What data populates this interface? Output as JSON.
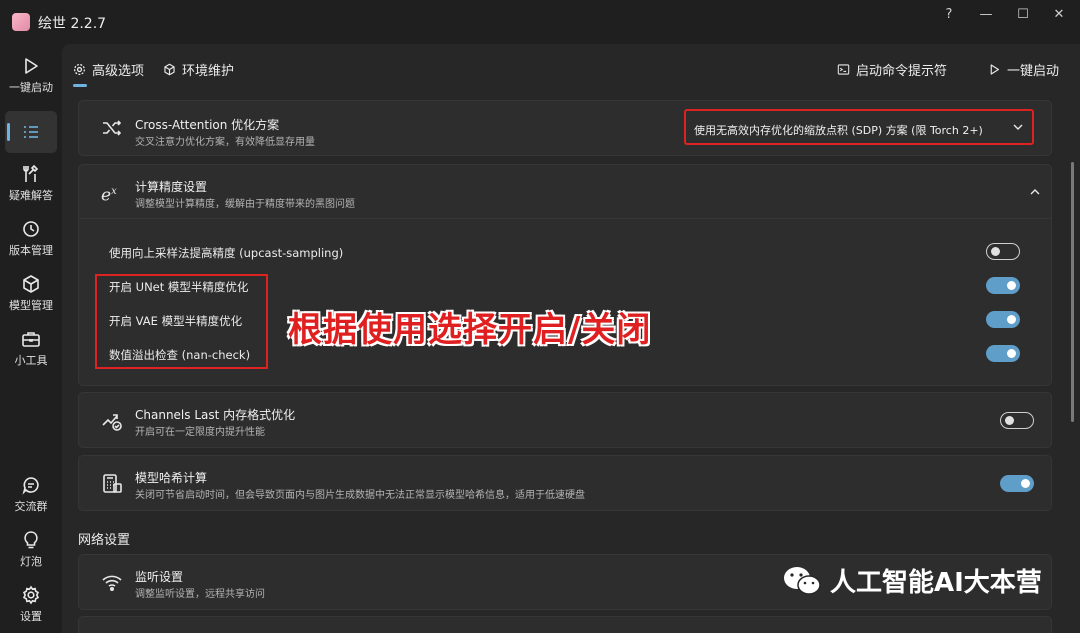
{
  "window": {
    "title": "绘世 2.2.7",
    "help": "?",
    "minimize": "—",
    "maximize": "☐",
    "close": "✕"
  },
  "sidebar": {
    "items": [
      {
        "label": "一键启动"
      },
      {
        "label": ""
      },
      {
        "label": "疑难解答"
      },
      {
        "label": "版本管理"
      },
      {
        "label": "模型管理"
      },
      {
        "label": "小工具"
      },
      {
        "label": "交流群"
      },
      {
        "label": "灯泡"
      },
      {
        "label": "设置"
      }
    ]
  },
  "topbar": {
    "tab_advanced": "高级选项",
    "tab_env": "环境维护",
    "cmd_prompt": "启动命令提示符",
    "one_click": "一键启动"
  },
  "cross_attention": {
    "title": "Cross-Attention 优化方案",
    "desc": "交叉注意力优化方案，有效降低显存用量",
    "selected": "使用无高效内存优化的缩放点积 (SDP) 方案 (限 Torch 2+)"
  },
  "precision": {
    "title": "计算精度设置",
    "desc": "调整模型计算精度，缓解由于精度带来的黑图问题",
    "rows": [
      {
        "label": "使用向上采样法提高精度 (upcast-sampling)",
        "on": false
      },
      {
        "label": "开启 UNet 模型半精度优化",
        "on": true
      },
      {
        "label": "开启 VAE 模型半精度优化",
        "on": true
      },
      {
        "label": "数值溢出检查 (nan-check)",
        "on": true
      }
    ]
  },
  "annotation": "根据使用选择开启/关闭",
  "channels_last": {
    "title": "Channels Last 内存格式优化",
    "desc": "开启可在一定限度内提升性能",
    "on": false
  },
  "model_hash": {
    "title": "模型哈希计算",
    "desc": "关闭可节省启动时间，但会导致页面内与图片生成数据中无法正常显示模型哈希信息，适用于低速硬盘",
    "on": true
  },
  "network": {
    "section_title": "网络设置",
    "listen": {
      "title": "监听设置",
      "desc": "调整监听设置，远程共享访问"
    }
  },
  "watermark": "人工智能AI大本营",
  "colors": {
    "accent": "#5f9ec9",
    "highlight": "#dd2222",
    "background": "#272727"
  }
}
